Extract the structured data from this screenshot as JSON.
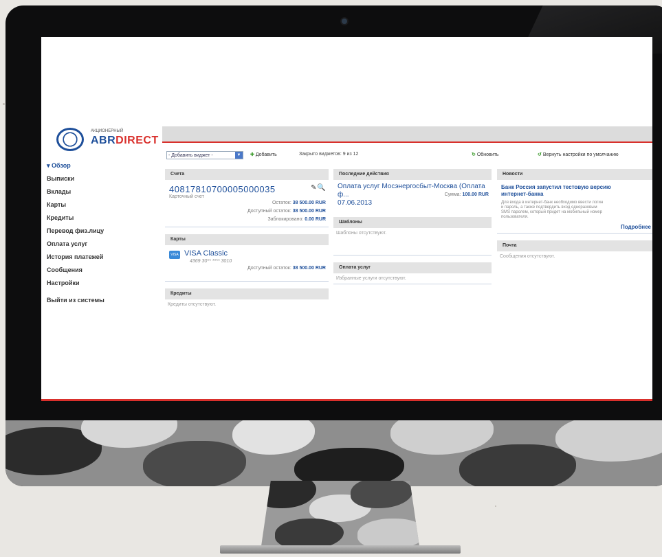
{
  "bank": {
    "logo_small": "АКЦИОНЕРНЫЙ",
    "logo_part1": "ABR",
    "logo_part2": "DIRECT"
  },
  "nav": {
    "items": [
      "Обзор",
      "Выписки",
      "Вклады",
      "Карты",
      "Кредиты",
      "Перевод физ.лицу",
      "Оплата услуг",
      "История платежей",
      "Сообщения",
      "Настройки"
    ],
    "logout": "Выйти из системы"
  },
  "toolbar": {
    "widget_select": "- Добавить виджет -",
    "add": "Добавить",
    "shown_count": "Закрыто виджетов: 9 из 12",
    "refresh": "Обновить",
    "reset": "Вернуть настройки по умолчанию"
  },
  "accounts": {
    "header": "Счета",
    "number": "40817810700005000035",
    "type": "Карточный счет",
    "balance_label": "Остаток:",
    "balance_value": "38 500.00 RUR",
    "available_label": "Доступный остаток:",
    "available_value": "38 500.00 RUR",
    "blocked_label": "Заблокировано:",
    "blocked_value": "0.00 RUR"
  },
  "cards": {
    "header": "Карты",
    "badge": "VISA",
    "name": "VISA Classic",
    "number": "4369 30** **** 3010",
    "available_label": "Доступный остаток:",
    "available_value": "38 500.00 RUR"
  },
  "credits": {
    "header": "Кредиты",
    "empty": "Кредиты отсутствуют."
  },
  "last_actions": {
    "header": "Последние действия",
    "text": "Оплата услуг Мосэнергосбыт-Москва (Оплата ф...",
    "date": "07.06.2013",
    "sum_label": "Сумма:",
    "sum_value": "100.00 RUR"
  },
  "templates": {
    "header": "Шаблоны",
    "empty": "Шаблоны отсутствуют."
  },
  "payments": {
    "header": "Оплата услуг",
    "empty": "Избранные услуги отсутствуют."
  },
  "news": {
    "header": "Новости",
    "title1": "Банк Россия запустил тестовую версию",
    "title2": "интернет-банка",
    "body1": "Для входа в интернет-банк необходимо ввести логин",
    "body2": "и пароль, а также подтвердить вход одноразовым",
    "body3": "SMS паролем, который придет на мобильный номер",
    "body4": "пользователя.",
    "more": "Подробнее"
  },
  "mail": {
    "header": "Почта",
    "empty": "Сообщения отсутствуют."
  },
  "colors": {
    "brand_blue": "#1e4f9a",
    "brand_red": "#d9302c",
    "action_green": "#3a9a2a"
  }
}
